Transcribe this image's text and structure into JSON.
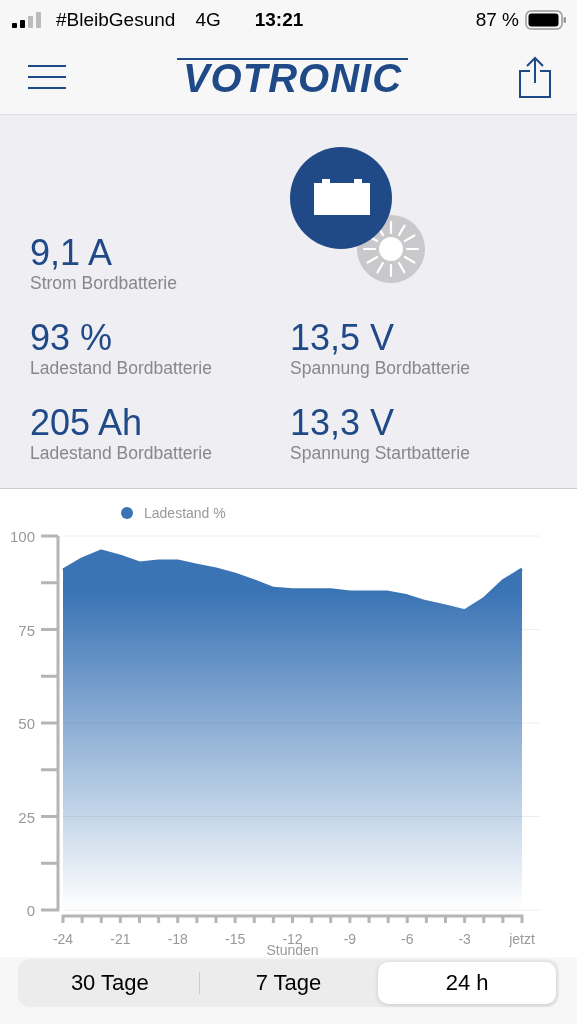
{
  "status_bar": {
    "carrier": "#BleibGesund",
    "network": "4G",
    "time": "13:21",
    "battery": "87 %"
  },
  "header": {
    "logo": "VOTRONIC"
  },
  "stats": [
    {
      "value": "9,1 A",
      "label": "Strom Bordbatterie"
    },
    {
      "value": "93 %",
      "label": "Ladestand Bordbatterie"
    },
    {
      "value": "13,5 V",
      "label": "Spannung Bordbatterie"
    },
    {
      "value": "205 Ah",
      "label": "Ladestand Bordbatterie"
    },
    {
      "value": "13,3 V",
      "label": "Spannung Startbatterie"
    }
  ],
  "chart": {
    "chart_data": {
      "type": "area",
      "xlabel": "Stunden",
      "x": [
        -24,
        -23,
        -22,
        -21,
        -20,
        -19,
        -18,
        -17,
        -16,
        -15,
        -14,
        -13,
        -12,
        -11,
        -10,
        -9,
        -8,
        -7,
        -6,
        -5,
        -4,
        -3,
        -2,
        -1,
        0
      ],
      "series": [
        {
          "name": "Ladestand %",
          "color": "#3a74b5",
          "values": [
            90.9,
            93.9,
            96,
            94.6,
            92.8,
            93.3,
            93.3,
            92.2,
            91.2,
            89.8,
            88,
            86,
            85.6,
            85.6,
            85.6,
            85,
            85,
            85,
            84,
            82.4,
            81.3,
            80,
            83.2,
            88,
            91.2
          ]
        }
      ],
      "xlim": [
        -24,
        0
      ],
      "ylim": [
        0,
        100
      ],
      "xticks": [
        -24,
        -21,
        -18,
        -15,
        -12,
        -9,
        -6,
        -3,
        {
          "value": 0,
          "label": "jetzt"
        }
      ],
      "yticks": [
        0,
        25,
        50,
        75,
        100
      ],
      "grid": true
    }
  },
  "range_tabs": [
    {
      "label": "30 Tage",
      "selected": false
    },
    {
      "label": "7 Tage",
      "selected": false
    },
    {
      "label": "24 h",
      "selected": true
    }
  ]
}
